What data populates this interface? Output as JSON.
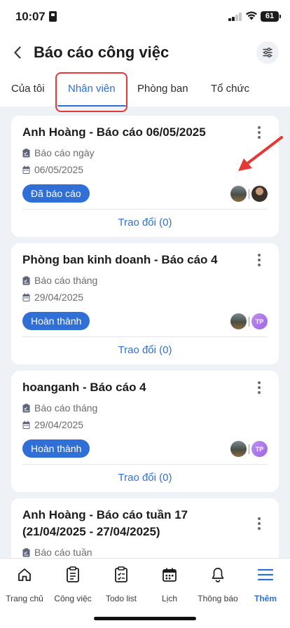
{
  "status_bar": {
    "time": "10:07",
    "battery": "61"
  },
  "header": {
    "title": "Báo cáo công việc"
  },
  "tabs": [
    {
      "label": "Của tôi",
      "active": false
    },
    {
      "label": "Nhân viên",
      "active": true
    },
    {
      "label": "Phòng ban",
      "active": false
    },
    {
      "label": "Tổ chức",
      "active": false
    }
  ],
  "reports": [
    {
      "title": "Anh Hoàng - Báo cáo 06/05/2025",
      "type": "Báo cáo ngày",
      "date": "06/05/2025",
      "status": "Đã báo cáo",
      "discuss": "Trao đổi (0)"
    },
    {
      "title": "Phòng ban kinh doanh - Báo cáo 4",
      "type": "Báo cáo tháng",
      "date": "29/04/2025",
      "status": "Hoàn thành",
      "assignee_initials": "TP",
      "discuss": "Trao đổi (0)"
    },
    {
      "title": "hoanganh - Báo cáo 4",
      "type": "Báo cáo tháng",
      "date": "29/04/2025",
      "status": "Hoàn thành",
      "assignee_initials": "TP",
      "discuss": "Trao đổi (0)"
    },
    {
      "title_line1": "Anh Hoàng - Báo cáo tuần 17",
      "title_line2": "(21/04/2025 - 27/04/2025)",
      "type": "Báo cáo tuần"
    }
  ],
  "bottom_nav": [
    {
      "label": "Trang chủ",
      "icon": "home-icon",
      "active": false
    },
    {
      "label": "Công việc",
      "icon": "clipboard-icon",
      "active": false
    },
    {
      "label": "Todo list",
      "icon": "checklist-icon",
      "active": false
    },
    {
      "label": "Lịch",
      "icon": "calendar-icon",
      "active": false
    },
    {
      "label": "Thông báo",
      "icon": "bell-icon",
      "active": false
    },
    {
      "label": "Thêm",
      "icon": "menu-icon",
      "active": true
    }
  ],
  "colors": {
    "accent": "#2f6fd6",
    "highlight": "#e53935",
    "background": "#eef2f7"
  }
}
